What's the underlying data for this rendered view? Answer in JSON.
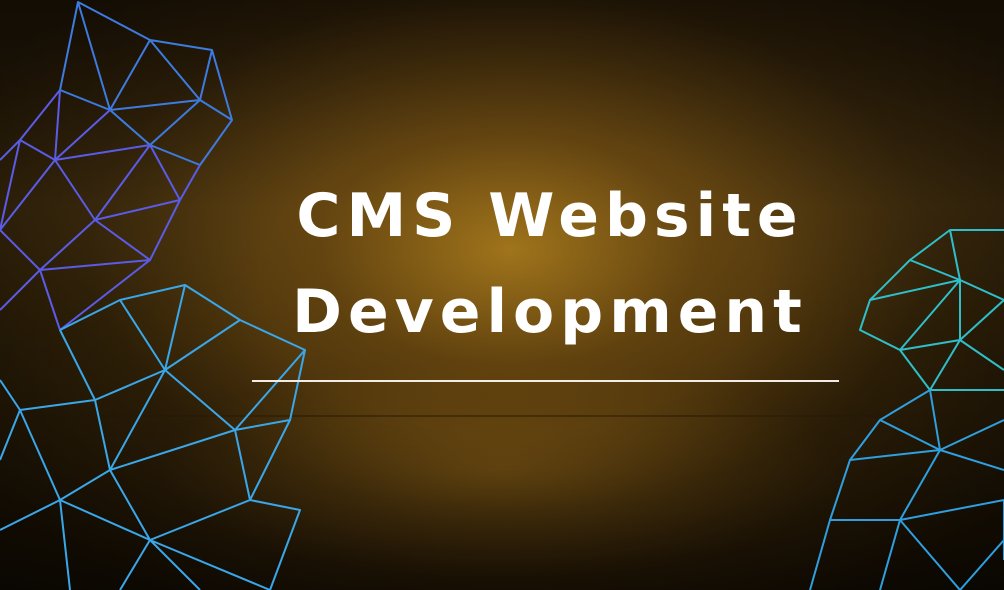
{
  "title": {
    "line1": "CMS Website",
    "line2": "Development"
  },
  "colors": {
    "background": "#3a2809",
    "text": "#ffffff",
    "mesh_left_upper": "#4a5ee0",
    "mesh_left_lower": "#3fa6e8",
    "mesh_right": "#35c9d6"
  },
  "decorations": {
    "left_mesh": "polygon-mesh-icon",
    "right_mesh": "polygon-mesh-icon"
  }
}
